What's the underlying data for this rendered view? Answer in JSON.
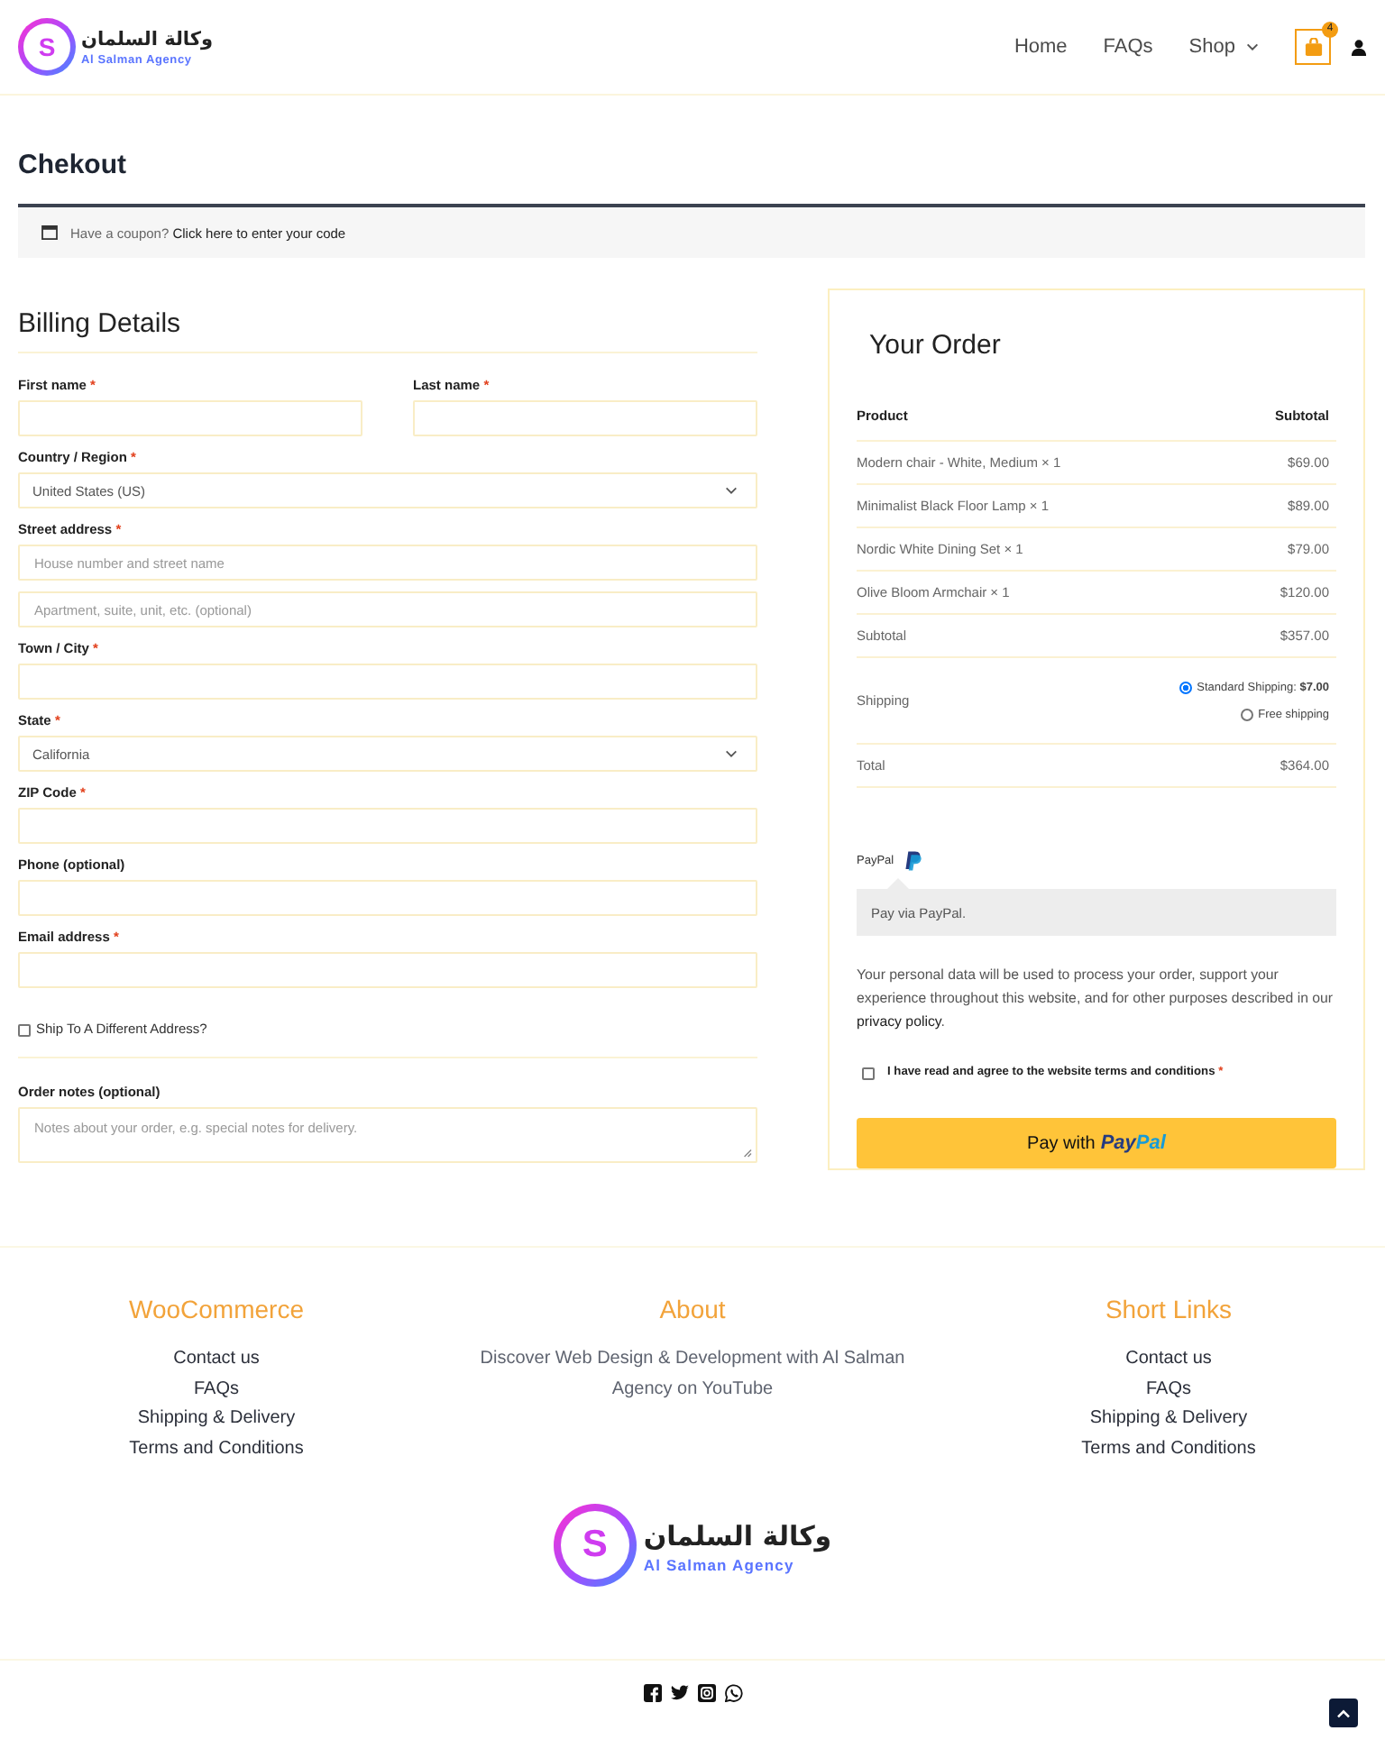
{
  "header": {
    "logo": {
      "mark": "S",
      "arabic": "وكالة السلمان",
      "latin": "Al Salman Agency"
    },
    "nav": [
      {
        "label": "Home",
        "has_menu": false
      },
      {
        "label": "FAQs",
        "has_menu": false
      },
      {
        "label": "Shop",
        "has_menu": true
      }
    ],
    "cart": {
      "count": "4"
    }
  },
  "page_title": "Chekout",
  "coupon": {
    "text": "Have a coupon?",
    "link": "Click here to enter your code"
  },
  "billing": {
    "title": "Billing Details",
    "rows": [
      [
        {
          "label": "First name",
          "mark": "*",
          "kind": "text"
        },
        {
          "label": "Last name",
          "mark": "*",
          "kind": "text"
        }
      ],
      [
        {
          "label": "Country / Region",
          "mark": "*",
          "kind": "select",
          "value": "United States (US)"
        }
      ],
      [
        {
          "label": "Street address",
          "mark": "*",
          "kind": "text",
          "placeholder": "House number and street name"
        }
      ],
      [
        {
          "kind": "text",
          "placeholder": "Apartment, suite, unit, etc. (optional)"
        }
      ],
      [
        {
          "label": "Town / City",
          "mark": "*",
          "kind": "text"
        }
      ],
      [
        {
          "label": "State",
          "mark": "*",
          "kind": "select",
          "value": "California"
        }
      ],
      [
        {
          "label": "ZIP Code",
          "mark": "*",
          "kind": "text"
        }
      ],
      [
        {
          "label": "Phone (optional)",
          "kind": "text"
        }
      ],
      [
        {
          "label": "Email address",
          "mark": "*",
          "kind": "text"
        }
      ]
    ],
    "ship_different": {
      "label": "Ship To A Different Address?",
      "checked": false
    },
    "notes": {
      "label": "Order notes (optional)",
      "placeholder": "Notes about your order, e.g. special notes for delivery."
    }
  },
  "order": {
    "title": "Your Order",
    "columns": [
      "Product",
      "Subtotal"
    ],
    "items": [
      {
        "name": "Modern chair - White, Medium × 1",
        "total": "$69.00"
      },
      {
        "name": "Minimalist Black Floor Lamp × 1",
        "total": "$89.00"
      },
      {
        "name": "Nordic White Dining Set × 1",
        "total": "$79.00"
      },
      {
        "name": "Olive Bloom Armchair × 1",
        "total": "$120.00"
      }
    ],
    "subtotal": {
      "label": "Subtotal",
      "value": "$357.00"
    },
    "shipping": {
      "label": "Shipping",
      "options": [
        {
          "label": "Standard Shipping: **$7.00**",
          "selected": true
        },
        {
          "label": "Free shipping",
          "selected": false
        }
      ]
    },
    "total": {
      "label": "Total",
      "value": "$364.00"
    }
  },
  "payment": {
    "method": "PayPal",
    "description": "Pay via PayPal.",
    "privacy": {
      "text": "Your personal data will be used to process your order, support your experience throughout this website, and for other purposes described in our",
      "link": "privacy policy",
      "end": "."
    },
    "terms": {
      "label": "I have read and agree to the website terms and conditions",
      "mark": "*",
      "checked": false
    },
    "button": {
      "label": "Pay with",
      "brand": [
        "Pay",
        "Pal"
      ]
    }
  },
  "footer": {
    "columns": [
      {
        "title": "WooCommerce",
        "links": [
          "Contact us",
          "FAQs",
          "Shipping & Delivery",
          "Terms and Conditions"
        ]
      },
      {
        "title": "About",
        "text": "Discover Web Design & Development with Al Salman Agency on YouTube"
      },
      {
        "title": "Short Links",
        "links": [
          "Contact us",
          "FAQs",
          "Shipping & Delivery",
          "Terms and Conditions"
        ]
      }
    ],
    "logo": {
      "mark": "S",
      "arabic": "وكالة السلمان",
      "latin": "Al Salman Agency"
    },
    "social": [
      {
        "kind": "facebook"
      },
      {
        "kind": "twitter"
      },
      {
        "kind": "instagram"
      },
      {
        "kind": "whatsapp"
      }
    ]
  }
}
